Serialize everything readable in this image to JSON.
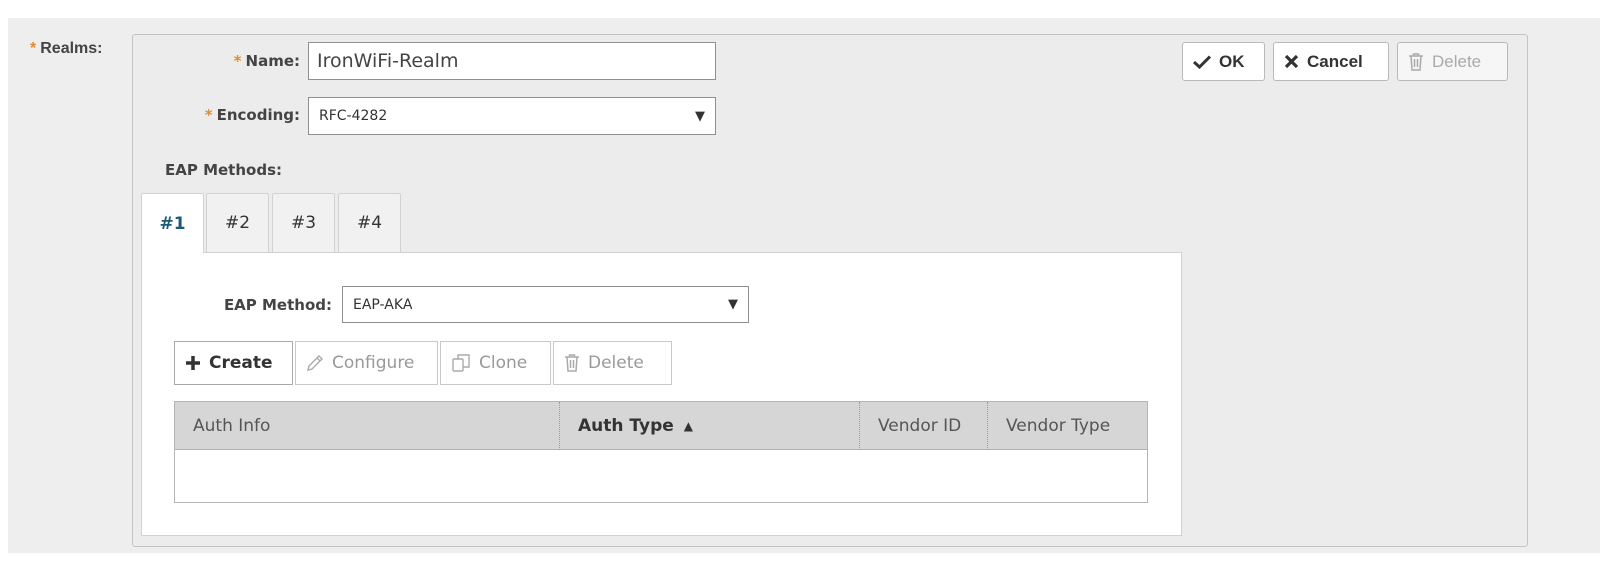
{
  "realms": {
    "label": "Realms:",
    "required_mark": "*"
  },
  "form": {
    "name": {
      "label": "Name:",
      "value": "IronWiFi-Realm",
      "required_mark": "*"
    },
    "encoding": {
      "label": "Encoding:",
      "value": "RFC-4282",
      "required_mark": "*"
    },
    "eap_methods_label": "EAP Methods:"
  },
  "actions": {
    "ok": "OK",
    "cancel": "Cancel",
    "delete": "Delete"
  },
  "tabs": [
    {
      "label": "#1",
      "active": true
    },
    {
      "label": "#2",
      "active": false
    },
    {
      "label": "#3",
      "active": false
    },
    {
      "label": "#4",
      "active": false
    }
  ],
  "eap_method": {
    "label": "EAP Method:",
    "value": "EAP-AKA"
  },
  "toolbar": {
    "create": "Create",
    "configure": "Configure",
    "clone": "Clone",
    "delete": "Delete"
  },
  "table": {
    "columns": [
      "Auth Info",
      "Auth Type",
      "Vendor ID",
      "Vendor Type"
    ],
    "sorted_column": "Auth Type",
    "rows": []
  },
  "colors": {
    "required": "#e8892b",
    "active_tab_text": "#1c5a78",
    "panel_bg": "#ececec"
  },
  "icons": {
    "ok": "check-icon",
    "cancel": "x-icon",
    "delete": "trash-icon",
    "create": "plus-icon",
    "configure": "pencil-icon",
    "clone": "clone-icon",
    "dropdown": "caret-down-icon",
    "sort": "sort-asc-icon"
  }
}
